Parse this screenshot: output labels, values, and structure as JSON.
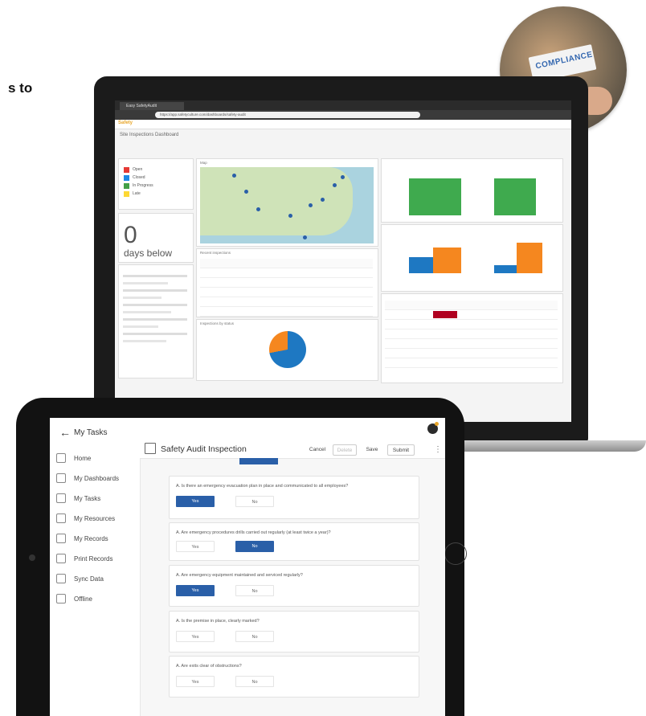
{
  "headline_fragment": "s to",
  "badge": {
    "text": "COMPLIANCE"
  },
  "laptop": {
    "browser_tab": "Easy SafetyAudit",
    "url": "https://app.safetyculture.com/dashboards/safety-audit",
    "app_name": "Safety",
    "page_heading": "Site Inspections Dashboard",
    "legend_items": [
      {
        "label": "Open",
        "color": "#e53935"
      },
      {
        "label": "Closed",
        "color": "#1e88e5"
      },
      {
        "label": "In Progress",
        "color": "#43a047"
      },
      {
        "label": "Late",
        "color": "#fdd835"
      }
    ],
    "big_number": "0",
    "big_number_sub": "days below",
    "map_title": "Map",
    "table_title": "Recent inspections",
    "pie_title": "Inspections by status"
  },
  "tablet": {
    "header": {
      "title": "My Tasks"
    },
    "nav": [
      {
        "label": "Home",
        "icon": "home-icon"
      },
      {
        "label": "My Dashboards",
        "icon": "dashboard-icon"
      },
      {
        "label": "My Tasks",
        "icon": "tasks-icon"
      },
      {
        "label": "My Resources",
        "icon": "resources-icon"
      },
      {
        "label": "My Records",
        "icon": "records-icon"
      },
      {
        "label": "Print Records",
        "icon": "print-icon"
      },
      {
        "label": "Sync Data",
        "icon": "sync-icon"
      },
      {
        "label": "Offline",
        "icon": "offline-icon"
      }
    ],
    "form_title": "Safety Audit Inspection",
    "toolbar": {
      "cancel": "Cancel",
      "delete": "Delete",
      "save": "Save",
      "submit": "Submit"
    },
    "questions": [
      {
        "text": "A. Is there an emergency evacuation plan in place and communicated to all employees?",
        "yes": "Yes",
        "no": "No",
        "selected": "yes"
      },
      {
        "text": "A. Are emergency procedures drills carried out regularly (at least twice a year)?",
        "yes": "Yes",
        "no": "No",
        "selected": "no"
      },
      {
        "text": "A. Are emergency equipment maintained and serviced regularly?",
        "yes": "Yes",
        "no": "No",
        "selected": "yes"
      },
      {
        "text": "A. Is the premise in place, clearly marked?",
        "yes": "Yes",
        "no": "No",
        "selected": "none"
      },
      {
        "text": "A. Are exits clear of obstructions?",
        "yes": "Yes",
        "no": "No",
        "selected": "none"
      }
    ]
  }
}
